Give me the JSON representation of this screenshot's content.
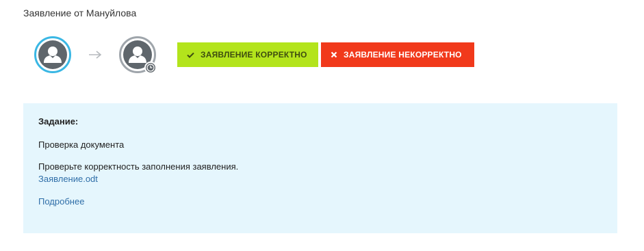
{
  "header": {
    "title": "Заявление от Мануйлова"
  },
  "workflow": {
    "steps": [
      {
        "icon": "user-icon",
        "state": "active"
      },
      {
        "icon": "user-icon",
        "state": "pending",
        "badge_icon": "clock-icon"
      }
    ],
    "connector_icon": "arrow-right-icon"
  },
  "actions": {
    "approve": {
      "label": "Заявление корректно",
      "icon": "checkmark-icon",
      "color": "#b3e41c"
    },
    "reject": {
      "label": "Заявление некорректно",
      "icon": "cross-icon",
      "color": "#f1391b"
    }
  },
  "task": {
    "heading": "Задание:",
    "name": "Проверка документа",
    "description": "Проверьте корректность заполнения заявления.",
    "attachment": "Заявление.odt",
    "more_link": "Подробнее",
    "background": "#e5f6fd"
  },
  "colors": {
    "active_ring": "#3ab7e4",
    "pending_ring": "#9fa5ab",
    "link": "#2f6ea8"
  }
}
